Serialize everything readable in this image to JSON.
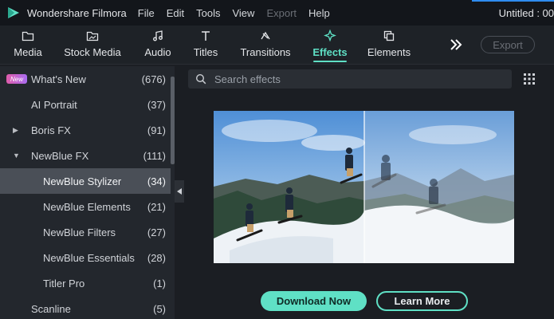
{
  "app": {
    "name": "Wondershare Filmora",
    "document_title": "Untitled : 00"
  },
  "menu": [
    "File",
    "Edit",
    "Tools",
    "View",
    "Export",
    "Help"
  ],
  "tabs": [
    {
      "label": "Media",
      "icon": "folder-icon"
    },
    {
      "label": "Stock Media",
      "icon": "image-folder-icon"
    },
    {
      "label": "Audio",
      "icon": "music-note-icon"
    },
    {
      "label": "Titles",
      "icon": "text-icon"
    },
    {
      "label": "Transitions",
      "icon": "transition-icon"
    },
    {
      "label": "Effects",
      "icon": "sparkle-icon",
      "active": true
    },
    {
      "label": "Elements",
      "icon": "layers-icon"
    }
  ],
  "toolbar": {
    "more_label": "»",
    "export_label": "Export"
  },
  "sidebar": {
    "new_badge": "New",
    "items": [
      {
        "label": "What's New",
        "count": "(676)"
      },
      {
        "label": "AI Portrait",
        "count": "(37)"
      },
      {
        "label": "Boris FX",
        "count": "(91)",
        "expander": "▶"
      },
      {
        "label": "NewBlue FX",
        "count": "(111)",
        "expander": "▼"
      },
      {
        "label": "NewBlue Stylizer",
        "count": "(34)",
        "selected": true
      },
      {
        "label": "NewBlue Elements",
        "count": "(21)"
      },
      {
        "label": "NewBlue Filters",
        "count": "(27)"
      },
      {
        "label": "NewBlue Essentials",
        "count": "(28)"
      },
      {
        "label": "Titler Pro",
        "count": "(1)"
      },
      {
        "label": "Scanline",
        "count": "(5)"
      }
    ]
  },
  "search": {
    "placeholder": "Search effects"
  },
  "preview": {
    "actions": {
      "download": "Download Now",
      "learn_more": "Learn More"
    }
  },
  "colors": {
    "accent": "#5fe0c5",
    "background": "#1b1e23",
    "sidebar": "#23272d",
    "selected": "#4a4f57"
  }
}
